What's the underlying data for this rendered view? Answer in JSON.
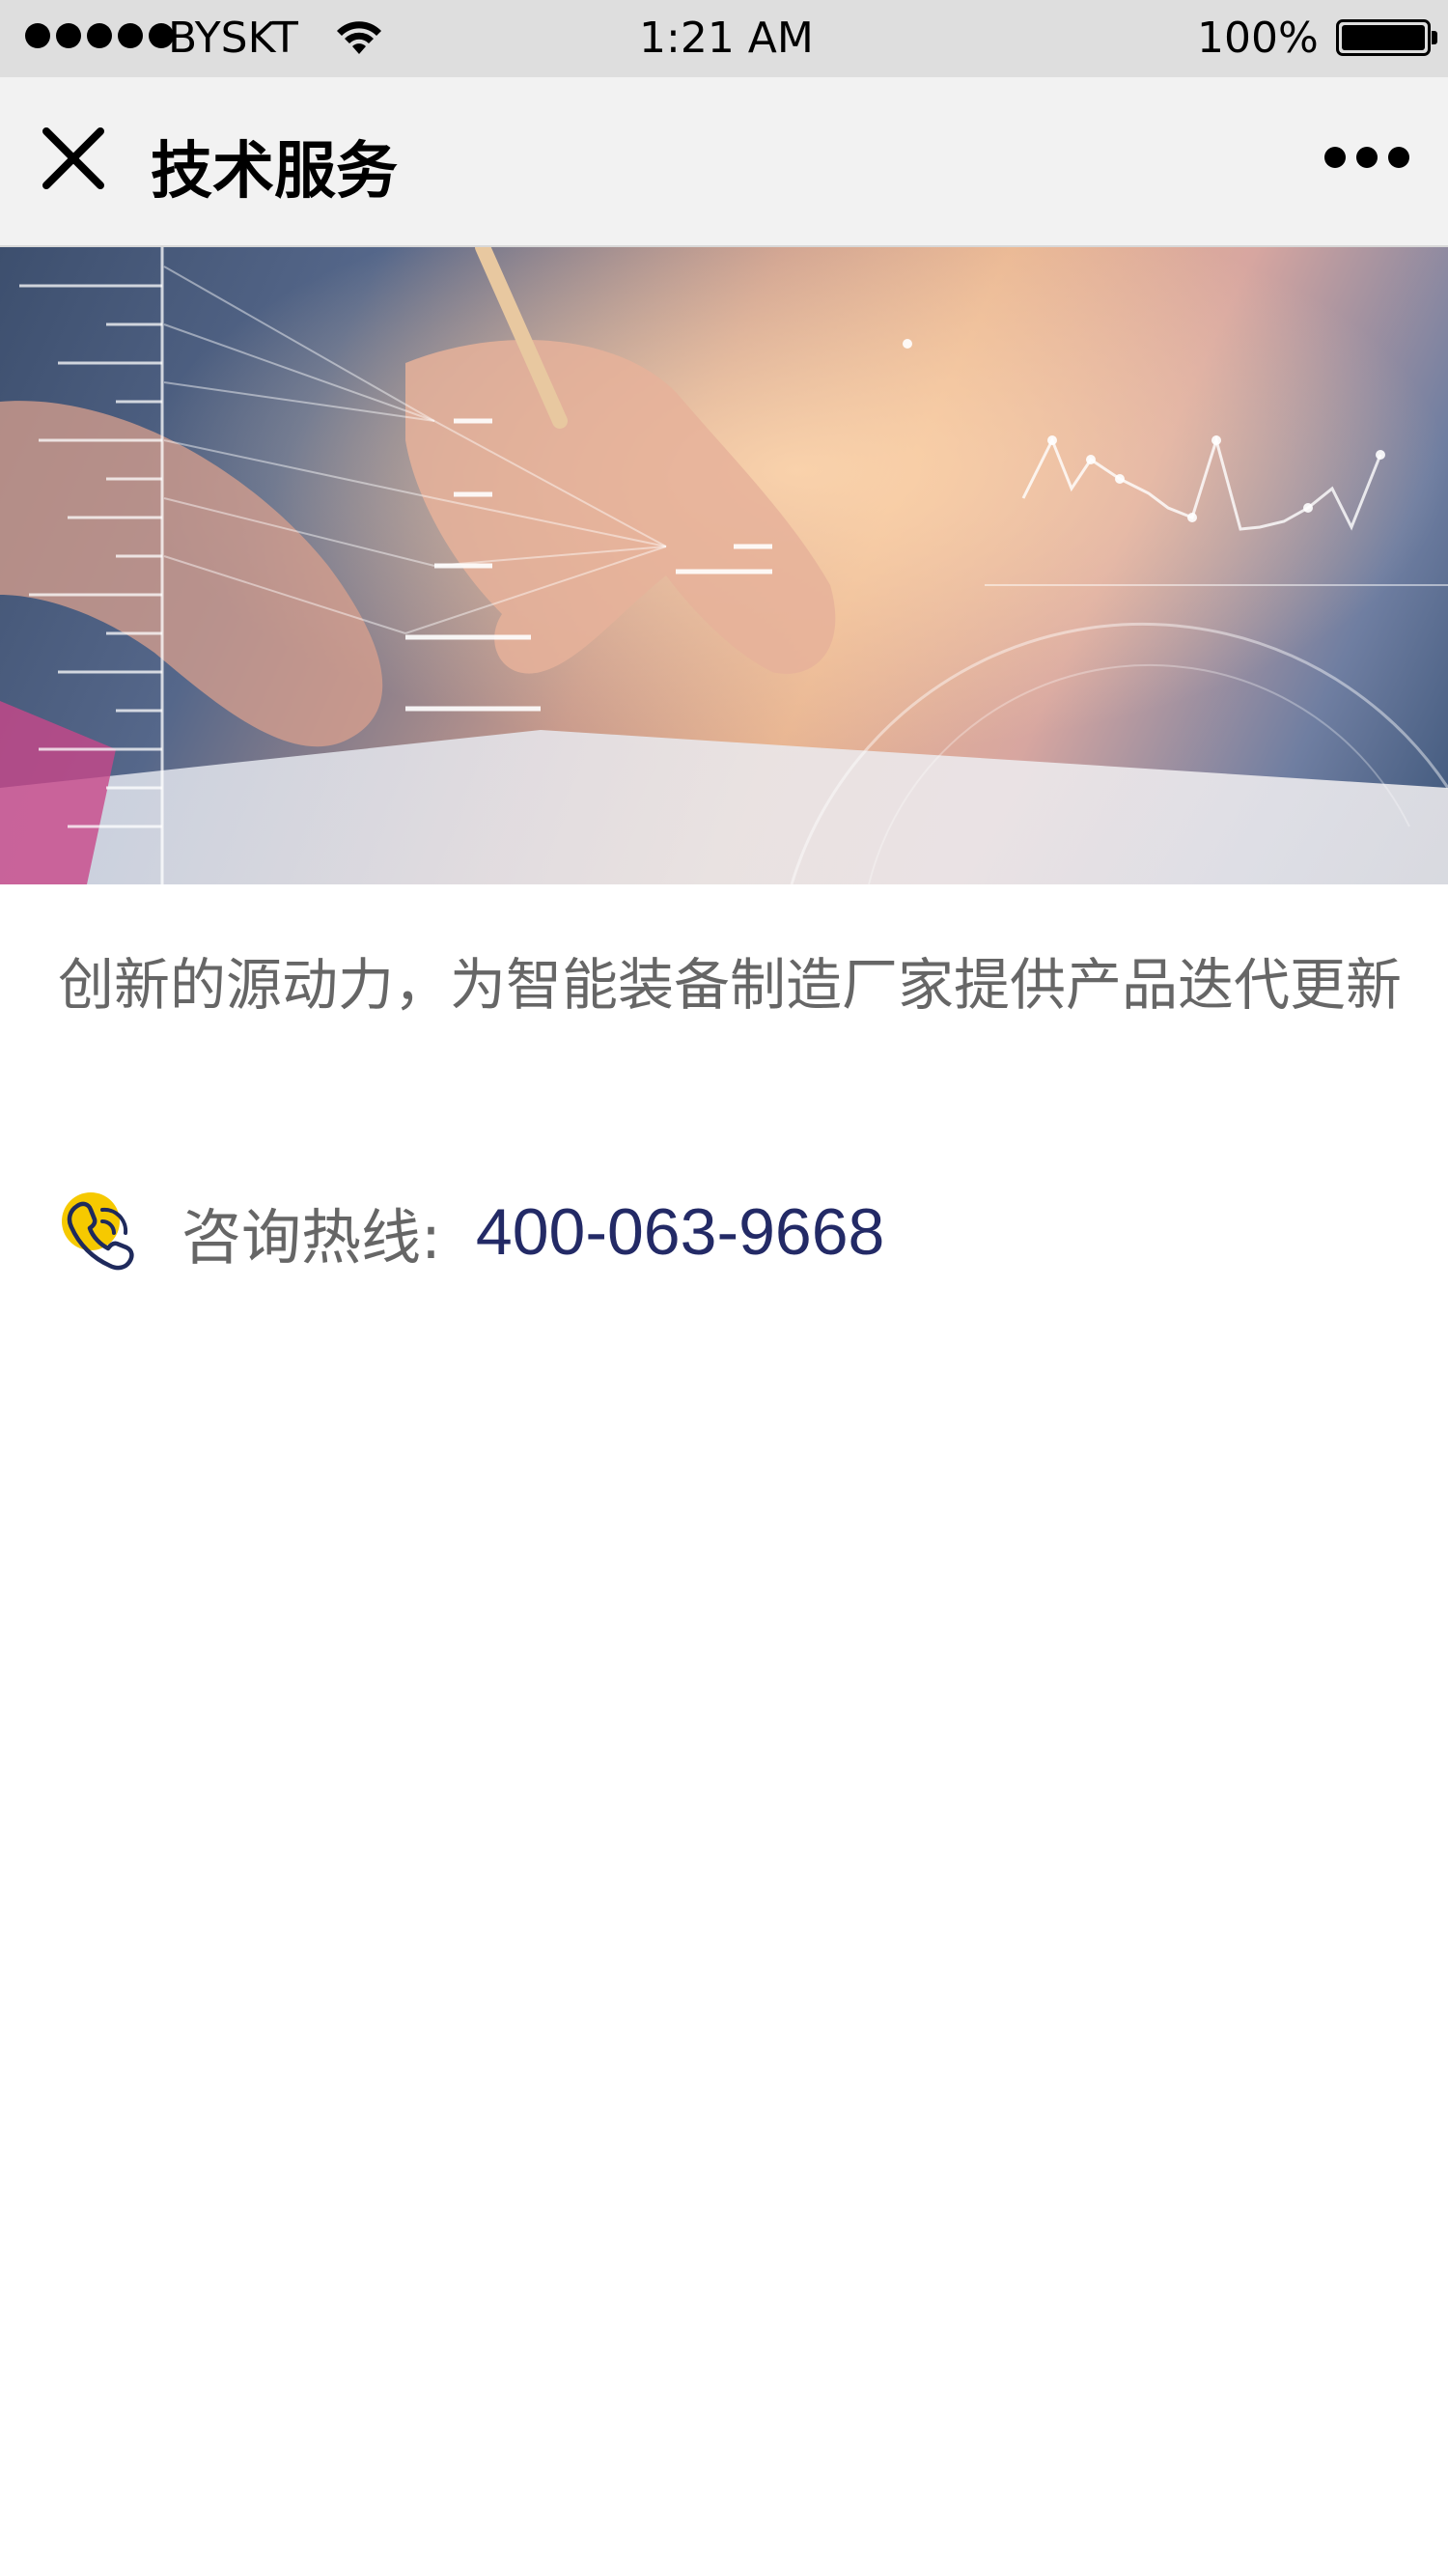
{
  "status_bar": {
    "carrier": "BYSKT",
    "time": "1:21 AM",
    "battery_percent": "100%",
    "signal_level": 5,
    "battery_level": 1.0,
    "icons": [
      "signal-dots-icon",
      "wifi-icon",
      "battery-icon"
    ]
  },
  "nav": {
    "title": "技术服务",
    "close_icon": "close-icon",
    "more_icon": "more-icon"
  },
  "banner": {
    "image": "hand-writing-with-data-graph-overlay"
  },
  "content": {
    "description": "创新的源动力，为智能装备制造厂家提供产品迭代更新",
    "hotline_label": "咨询热线:",
    "hotline_number": "400-063-9668",
    "hotline_icon": "phone-icon"
  },
  "colors": {
    "status_bar_bg": "#dedede",
    "nav_bg": "#f2f2f2",
    "text_gray": "#666666",
    "number_navy": "#232a66",
    "icon_yellow": "#f6c900"
  }
}
